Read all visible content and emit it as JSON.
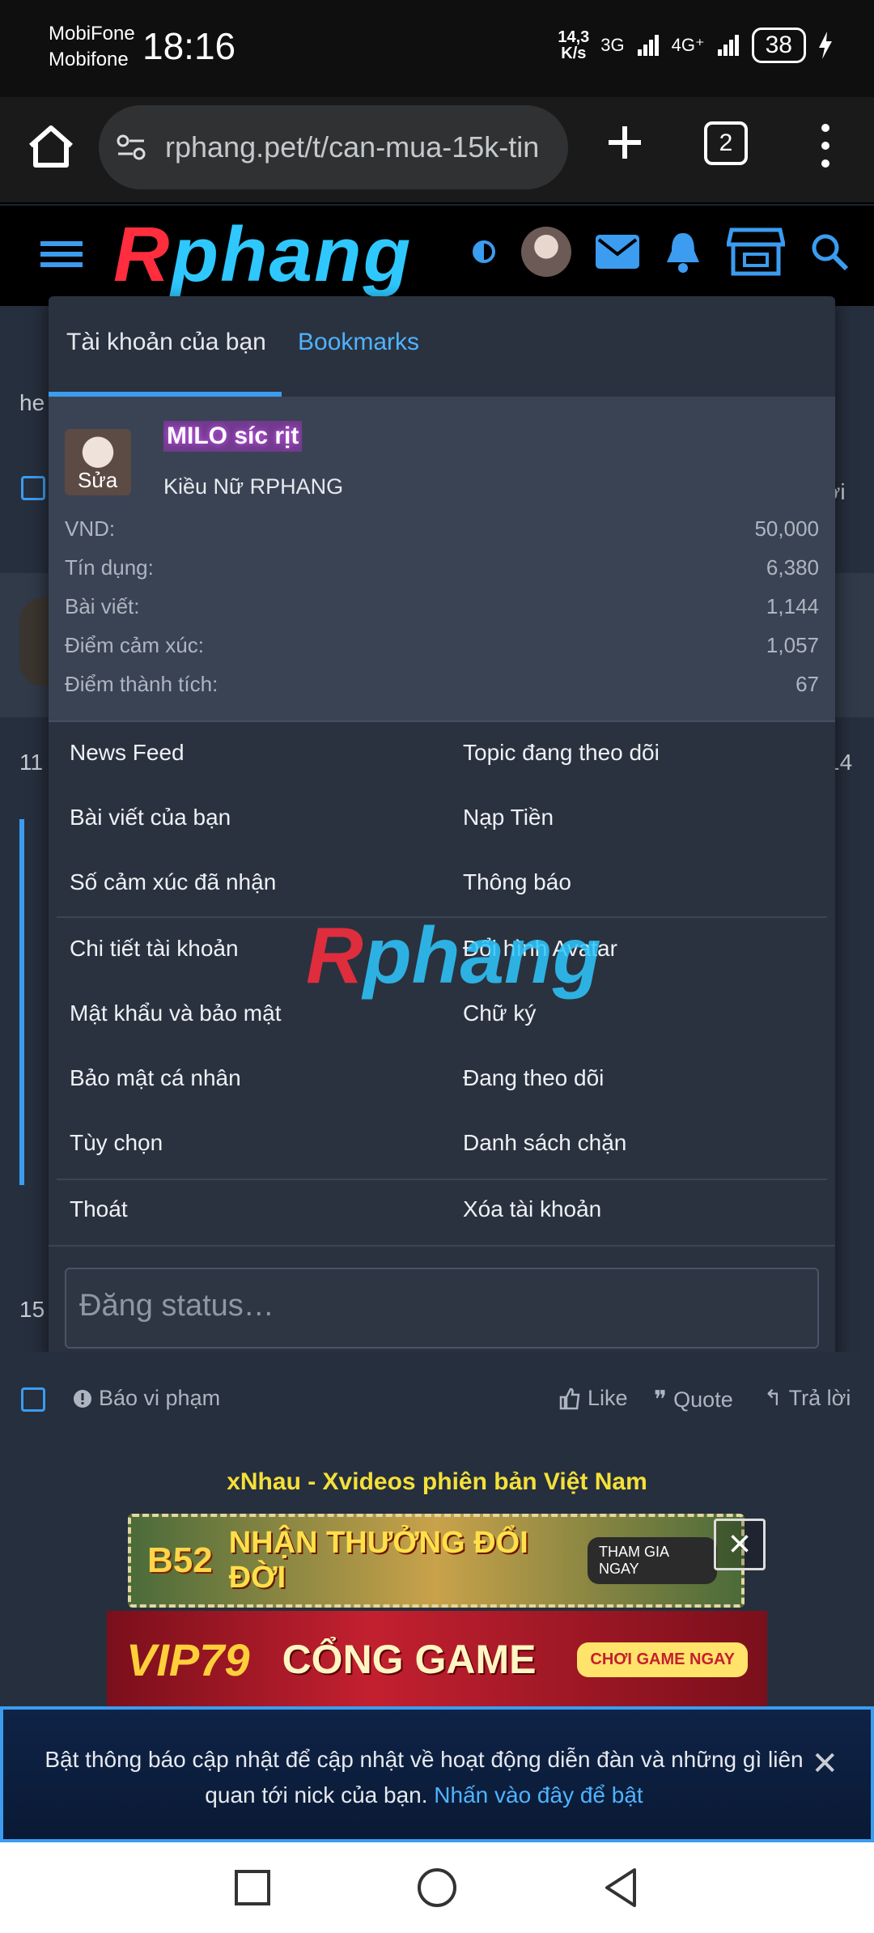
{
  "status_bar": {
    "carrier_line1": "MobiFone",
    "carrier_line2": "Mobifone",
    "time": "18:16",
    "net_speed_value": "14,3",
    "net_speed_unit": "K/s",
    "net_type_1": "3G",
    "net_type_2": "4G⁺",
    "battery": "38"
  },
  "browser": {
    "url": "rphang.pet/t/can-mua-15k-tin",
    "tab_count": "2"
  },
  "site": {
    "logo_r": "R",
    "logo_rest": "phang"
  },
  "background": {
    "snippet_he": "he",
    "snippet_loi": "ời",
    "post_num_left": "11",
    "post_num_right": "14",
    "post_num_15": "15"
  },
  "dropdown": {
    "tab_account": "Tài khoản của bạn",
    "tab_bookmarks": "Bookmarks",
    "profile": {
      "edit_label": "Sửa",
      "username": "MILO síc rịt",
      "user_title": "Kiều Nữ RPHANG"
    },
    "stats": [
      {
        "label": "VND:",
        "value": "50,000"
      },
      {
        "label": "Tín dụng:",
        "value": "6,380"
      },
      {
        "label": "Bài viết:",
        "value": "1,144"
      },
      {
        "label": "Điểm cảm xúc:",
        "value": "1,057"
      },
      {
        "label": "Điểm thành tích:",
        "value": "67"
      }
    ],
    "links": {
      "news_feed": "News Feed",
      "watched_topics": "Topic đang theo dõi",
      "your_posts": "Bài viết của bạn",
      "deposit": "Nạp Tiền",
      "reactions_received": "Số cảm xúc đã nhận",
      "alerts": "Thông báo",
      "account_details": "Chi tiết tài khoản",
      "change_avatar": "Đổi hình Avatar",
      "password_security": "Mật khẩu và bảo mật",
      "signature": "Chữ ký",
      "privacy": "Bảo mật cá nhân",
      "following": "Đang theo dõi",
      "preferences": "Tùy chọn",
      "ignored": "Danh sách chặn",
      "logout": "Thoát",
      "delete_account": "Xóa tài khoản"
    },
    "status_placeholder": "Đăng status…"
  },
  "post_footer": {
    "report": "Báo vi phạm",
    "like": "Like",
    "quote": "Quote",
    "reply": "Trả lời"
  },
  "ads": {
    "title": "xNhau - Xvideos phiên bản Việt Nam",
    "banner1_brand": "B52",
    "banner1_msg": "NHẬN THƯỞNG ĐỔI ĐỜI",
    "banner1_cta": "THAM GIA NGAY",
    "banner2_brand": "VIP79",
    "banner2_msg": "CỔNG GAME",
    "banner2_cta": "CHƠI GAME NGAY"
  },
  "notification": {
    "text": "Bật thông báo cập nhật để cập nhật về hoạt động diễn đàn và những gì liên quan tới nick của bạn.",
    "link": "Nhấn vào đây để bật"
  },
  "colors": {
    "accent": "#3b9cf0",
    "panel": "#2a323f",
    "username_glow": "#d35cff"
  }
}
